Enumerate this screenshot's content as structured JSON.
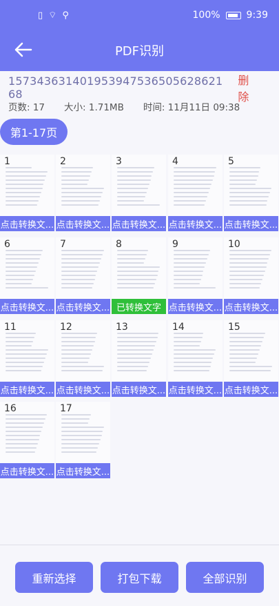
{
  "status": {
    "left_icons": [
      "sim-icon",
      "wifi-icon",
      "usb-icon"
    ],
    "battery_percent": "100%",
    "time": "9:39"
  },
  "header": {
    "title": "PDF识别"
  },
  "document": {
    "id": "157343631401953947536505628621 68",
    "delete_label": "删除",
    "pages_label": "页数: 17",
    "size_label": "大小: 1.71MB",
    "time_label": "时间: 11月11日 09:38"
  },
  "range_pill": {
    "label": "第1-17页"
  },
  "pages": [
    {
      "num": "1",
      "label": "点击转换文..."
    },
    {
      "num": "2",
      "label": "点击转换文..."
    },
    {
      "num": "3",
      "label": "点击转换文..."
    },
    {
      "num": "4",
      "label": "点击转换文..."
    },
    {
      "num": "5",
      "label": "点击转换文..."
    },
    {
      "num": "6",
      "label": "点击转换文..."
    },
    {
      "num": "7",
      "label": "点击转换文..."
    },
    {
      "num": "8",
      "label": "已转换文字"
    },
    {
      "num": "9",
      "label": "点击转换文..."
    },
    {
      "num": "10",
      "label": "点击转换文..."
    },
    {
      "num": "11",
      "label": "点击转换文..."
    },
    {
      "num": "12",
      "label": "点击转换文..."
    },
    {
      "num": "13",
      "label": "点击转换文..."
    },
    {
      "num": "14",
      "label": "点击转换文..."
    },
    {
      "num": "15",
      "label": "点击转换文..."
    },
    {
      "num": "16",
      "label": "点击转换文..."
    },
    {
      "num": "17",
      "label": "点击转换文..."
    }
  ],
  "actions": {
    "reselect": "重新选择",
    "download": "打包下载",
    "recognize_all": "全部识别"
  },
  "colors": {
    "accent": "#6f77f1",
    "success": "#2fbf3a",
    "danger": "#e0514a"
  }
}
